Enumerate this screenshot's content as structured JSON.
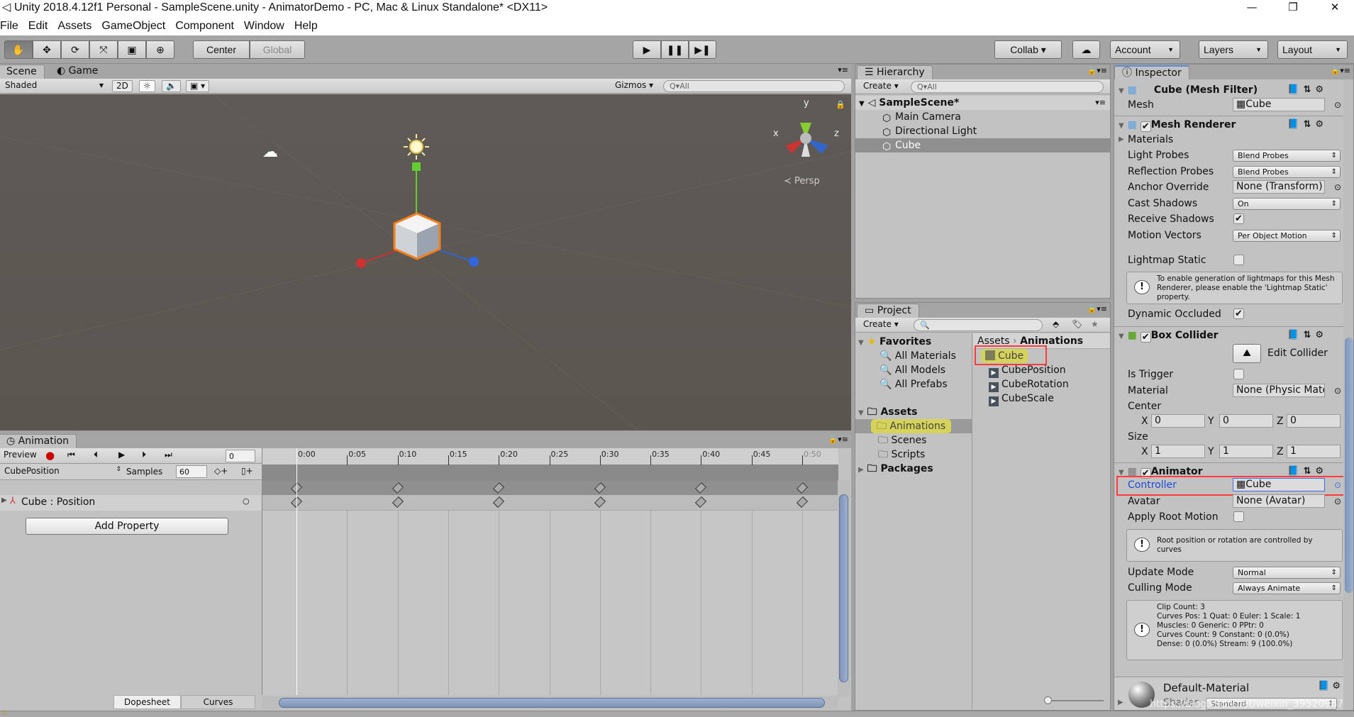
{
  "window": {
    "title": "Unity 2018.4.12f1 Personal - SampleScene.unity - AnimatorDemo - PC, Mac & Linux Standalone* <DX11>",
    "minimize": "—",
    "maximize": "❐",
    "close": "✕"
  },
  "menu": [
    "File",
    "Edit",
    "Assets",
    "GameObject",
    "Component",
    "Window",
    "Help"
  ],
  "toolbar": {
    "tools": [
      "hand-tool",
      "move-tool",
      "rotate-tool",
      "scale-tool",
      "rect-tool",
      "transform-tool"
    ],
    "pivot": "Center",
    "space": "Global",
    "collab": "Collab ▾",
    "account": "Account",
    "layers": "Layers",
    "layout": "Layout"
  },
  "scene": {
    "tabs": [
      "Scene",
      "Game"
    ],
    "shading": "Shaded",
    "mode2d": "2D",
    "gizmos": "Gizmos",
    "search_placeholder": "All",
    "persp": "Persp",
    "axes": {
      "x": "x",
      "y": "y",
      "z": "z"
    }
  },
  "animation": {
    "tab": "Animation",
    "preview": "Preview",
    "frame": "0",
    "clip": "CubePosition",
    "samples_label": "Samples",
    "samples": "60",
    "property": "Cube : Position",
    "add_property": "Add Property",
    "modes": [
      "Dopesheet",
      "Curves"
    ],
    "ruler": [
      "0:00",
      "0:05",
      "0:10",
      "0:15",
      "0:20",
      "0:25",
      "0:30",
      "0:35",
      "0:40",
      "0:45",
      "0:50"
    ],
    "keyframes": [
      "0:00",
      "0:10",
      "0:20",
      "0:30",
      "0:40",
      "0:50"
    ]
  },
  "hierarchy": {
    "tab": "Hierarchy",
    "create": "Create",
    "search_placeholder": "All",
    "scene": "SampleScene*",
    "items": [
      "Main Camera",
      "Directional Light",
      "Cube"
    ],
    "selected": "Cube"
  },
  "project": {
    "tab": "Project",
    "create": "Create",
    "favorites": {
      "label": "Favorites",
      "items": [
        "All Materials",
        "All Models",
        "All Prefabs"
      ]
    },
    "assets": {
      "label": "Assets",
      "items": [
        "Animations",
        "Scenes",
        "Scripts"
      ]
    },
    "packages": "Packages",
    "breadcrumb": [
      "Assets",
      "Animations"
    ],
    "files": [
      {
        "name": "Cube",
        "type": "animator-controller",
        "highlighted": true
      },
      {
        "name": "CubePosition",
        "type": "animation-clip"
      },
      {
        "name": "CubeRotation",
        "type": "animation-clip"
      },
      {
        "name": "CubeScale",
        "type": "animation-clip"
      }
    ]
  },
  "inspector": {
    "tab": "Inspector",
    "mesh_filter": {
      "title": "Cube (Mesh Filter)",
      "mesh_label": "Mesh",
      "mesh": "Cube"
    },
    "mesh_renderer": {
      "title": "Mesh Renderer",
      "enabled": true,
      "materials": "Materials",
      "light_probes": [
        "Light Probes",
        "Blend Probes"
      ],
      "reflection_probes": [
        "Reflection Probes",
        "Blend Probes"
      ],
      "anchor_override": [
        "Anchor Override",
        "None (Transform)"
      ],
      "cast_shadows": [
        "Cast Shadows",
        "On"
      ],
      "receive_shadows": [
        "Receive Shadows",
        true
      ],
      "motion_vectors": [
        "Motion Vectors",
        "Per Object Motion"
      ],
      "lightmap_static": [
        "Lightmap Static",
        false
      ],
      "help": "To enable generation of lightmaps for this Mesh Renderer, please enable the 'Lightmap Static' property.",
      "dynamic_occluded": [
        "Dynamic Occluded",
        true
      ]
    },
    "box_collider": {
      "title": "Box Collider",
      "enabled": true,
      "edit": "Edit Collider",
      "is_trigger": [
        "Is Trigger",
        false
      ],
      "material": [
        "Material",
        "None (Physic Mate"
      ],
      "center": {
        "label": "Center",
        "x": "0",
        "y": "0",
        "z": "0"
      },
      "size": {
        "label": "Size",
        "x": "1",
        "y": "1",
        "z": "1"
      }
    },
    "animator": {
      "title": "Animator",
      "enabled": true,
      "controller": [
        "Controller",
        "Cube"
      ],
      "avatar": [
        "Avatar",
        "None (Avatar)"
      ],
      "apply_root_motion": [
        "Apply Root Motion",
        false
      ],
      "help": "Root position or rotation are controlled by curves",
      "update_mode": [
        "Update Mode",
        "Normal"
      ],
      "culling_mode": [
        "Culling Mode",
        "Always Animate"
      ],
      "info": [
        "Clip Count: 3",
        "Curves Pos: 1 Quat: 0 Euler: 1 Scale: 1",
        "Muscles: 0 Generic: 0 PPtr: 0",
        "Curves Count: 9 Constant: 0 (0.0%)",
        "Dense: 0 (0.0%) Stream: 9 (100.0%)"
      ]
    },
    "material": {
      "name": "Default-Material",
      "shader_label": "Shader",
      "shader": "Standard"
    }
  },
  "watermark": "https://blog.csdn.net/weixin_39520967",
  "colors": {
    "highlight": "#ff3b3b",
    "selection": "#d6d35a",
    "link": "#1a4bd8"
  }
}
